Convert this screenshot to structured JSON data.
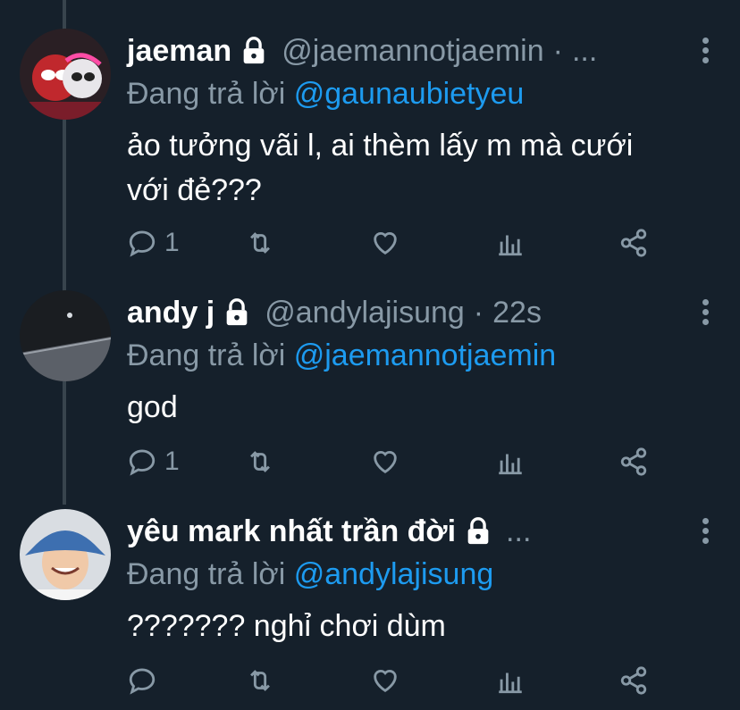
{
  "thread": [
    {
      "name": "jaeman",
      "handle": "@jaemannotjaemin",
      "time": "...",
      "reply_prefix": "Đang trả lời",
      "reply_to": "@gaunaubietyeu",
      "text_lines": [
        "ảo tưởng vãi l, ai thèm lấy m mà cưới",
        "với đẻ???"
      ],
      "reply_count": "1",
      "avatar_icon": "spiderman-avatar"
    },
    {
      "name": "andy j",
      "handle": "@andylajisung",
      "time": "22s",
      "reply_prefix": "Đang trả lời",
      "reply_to": "@jaemannotjaemin",
      "text_lines": [
        "god"
      ],
      "reply_count": "1",
      "avatar_icon": "dark-room-avatar"
    },
    {
      "name": "yêu mark nhất trần đời",
      "handle": "",
      "time": "...",
      "reply_prefix": "Đang trả lời",
      "reply_to": "@andylajisung",
      "text_lines": [
        "??????? nghỉ chơi dùm"
      ],
      "reply_count": "",
      "avatar_icon": "bucket-hat-avatar"
    }
  ],
  "colors": {
    "background": "#15202b",
    "secondary_text": "#8899a6",
    "link": "#1d9bf0",
    "thread_line": "#38444d"
  },
  "icons": [
    "reply-icon",
    "retweet-icon",
    "like-icon",
    "analytics-icon",
    "share-icon",
    "lock-icon",
    "more-icon"
  ]
}
